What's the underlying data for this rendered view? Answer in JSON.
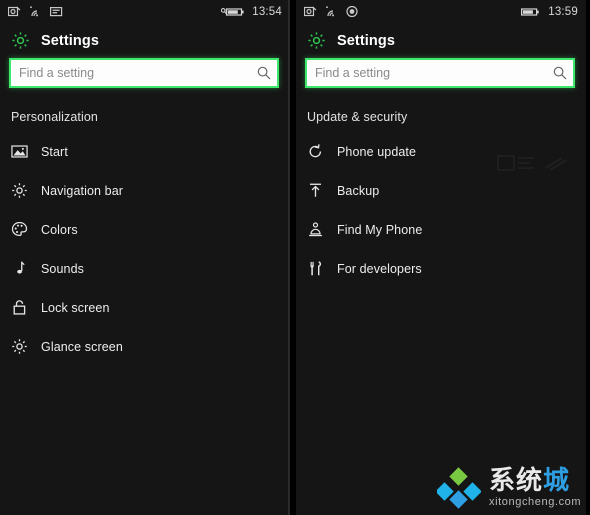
{
  "colors": {
    "accent_green": "#3ee86b",
    "panel_bg": "#151515",
    "text_primary": "#ededed",
    "watermark_blue": "#2f9fe3"
  },
  "screens": [
    {
      "id": "left",
      "statusbar": {
        "left_icons": [
          "screenshot-icon",
          "wifi-icon",
          "message-icon"
        ],
        "right_icons": [
          "battery-icon"
        ],
        "time": "13:54"
      },
      "header": {
        "icon": "gear-icon",
        "title": "Settings"
      },
      "search": {
        "value": "",
        "placeholder": "Find a setting",
        "icon": "search-icon"
      },
      "group_header": "Personalization",
      "items": [
        {
          "label": "Start",
          "icon": "picture-icon"
        },
        {
          "label": "Navigation bar",
          "icon": "gear-icon"
        },
        {
          "label": "Colors",
          "icon": "palette-icon"
        },
        {
          "label": "Sounds",
          "icon": "music-note-icon"
        },
        {
          "label": "Lock screen",
          "icon": "lock-icon"
        },
        {
          "label": "Glance screen",
          "icon": "gear-icon"
        }
      ]
    },
    {
      "id": "right",
      "statusbar": {
        "left_icons": [
          "screenshot-icon",
          "wifi-icon",
          "record-icon"
        ],
        "right_icons": [
          "battery-icon"
        ],
        "time": "13:59"
      },
      "header": {
        "icon": "gear-icon",
        "title": "Settings"
      },
      "search": {
        "value": "",
        "placeholder": "Find a setting",
        "icon": "search-icon"
      },
      "group_header": "Update & security",
      "items": [
        {
          "label": "Phone update",
          "icon": "refresh-icon"
        },
        {
          "label": "Backup",
          "icon": "upload-icon"
        },
        {
          "label": "Find My Phone",
          "icon": "find-phone-icon"
        },
        {
          "label": "For developers",
          "icon": "tools-icon"
        }
      ]
    }
  ],
  "watermark": {
    "cn_part1": "系",
    "cn_part2": "统",
    "cn_part3": "城",
    "domain": "xitongcheng.com"
  }
}
